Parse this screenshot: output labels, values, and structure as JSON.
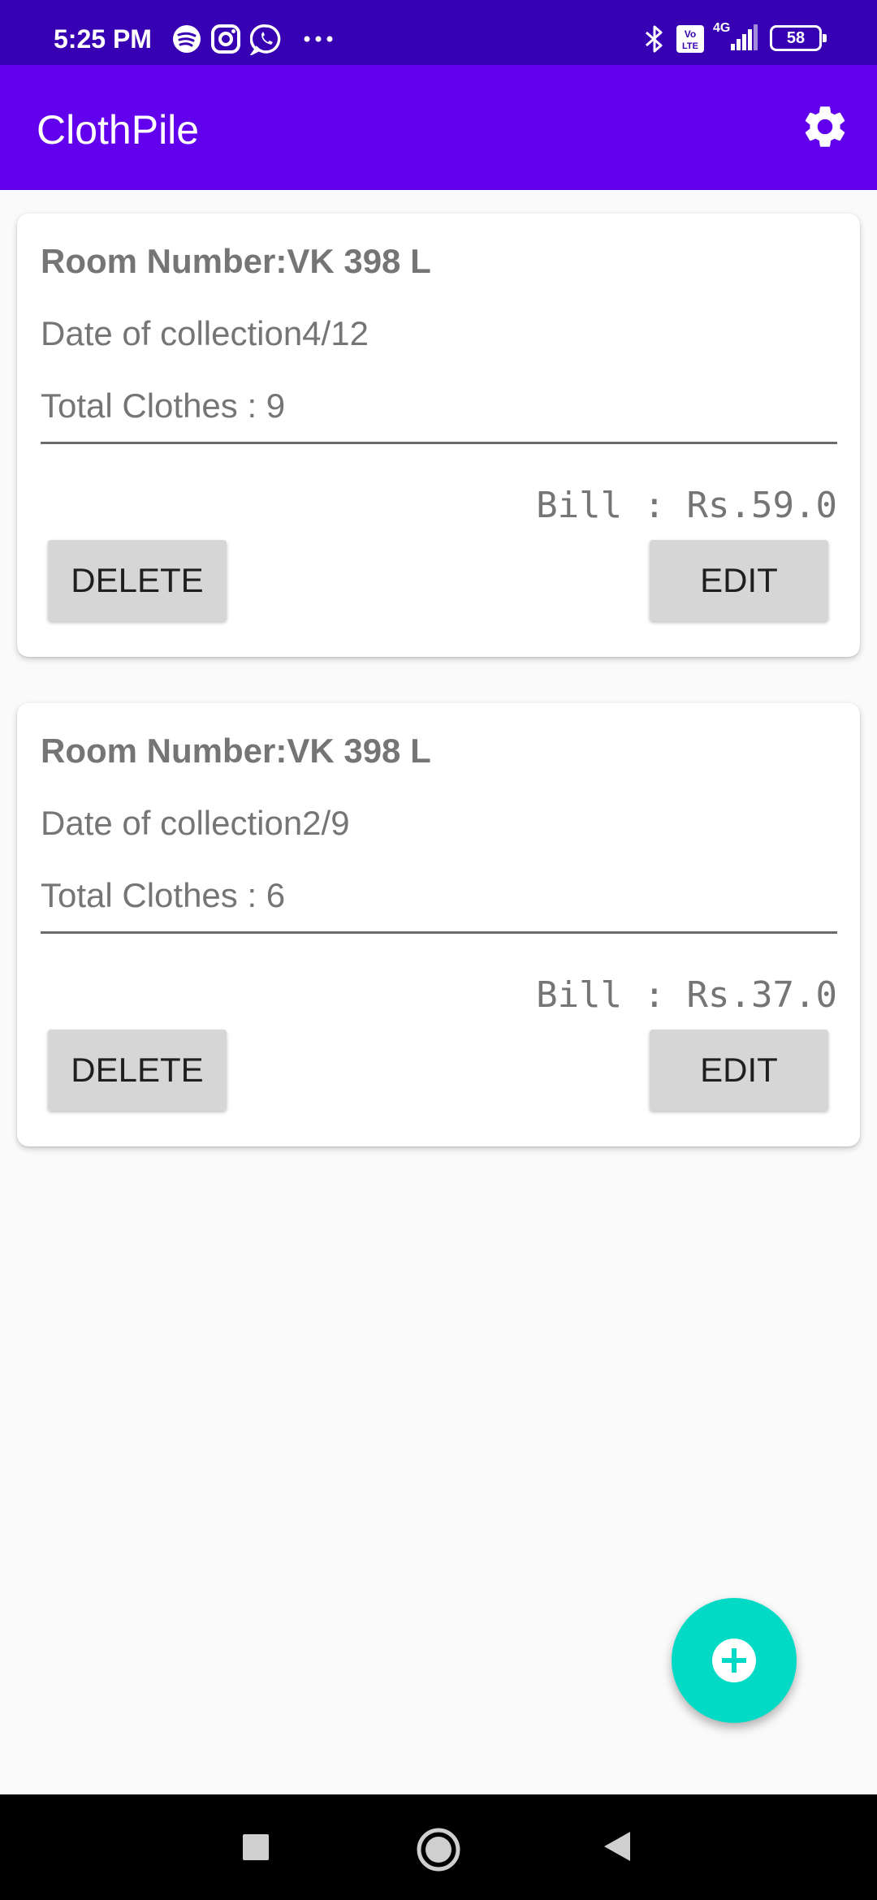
{
  "status_bar": {
    "time": "5:25 PM",
    "battery": "58",
    "network": "4G",
    "icons_left": [
      "spotify-icon",
      "instagram-icon",
      "whatsapp-icon",
      "more-icon"
    ],
    "icons_right": [
      "bluetooth-icon",
      "volte-icon",
      "signal-icon",
      "battery-icon"
    ]
  },
  "app_bar": {
    "title": "ClothPile",
    "settings_icon": "gear-icon"
  },
  "cards": [
    {
      "room": "Room Number:VK 398 L",
      "date": "Date of collection4/12",
      "total": "Total Clothes : 9",
      "bill": "Bill : Rs.59.0",
      "delete_label": "DELETE",
      "edit_label": "EDIT"
    },
    {
      "room": "Room Number:VK 398 L",
      "date": "Date of collection2/9",
      "total": "Total Clothes : 6",
      "bill": "Bill : Rs.37.0",
      "delete_label": "DELETE",
      "edit_label": "EDIT"
    }
  ],
  "fab": {
    "icon": "add-circle-icon"
  },
  "nav_bar": {
    "icons": [
      "recents-icon",
      "home-icon",
      "back-icon"
    ]
  },
  "colors": {
    "status_bar": "#3700b3",
    "app_bar": "#6200ee",
    "fab": "#03dac5",
    "button": "#d6d6d6"
  }
}
